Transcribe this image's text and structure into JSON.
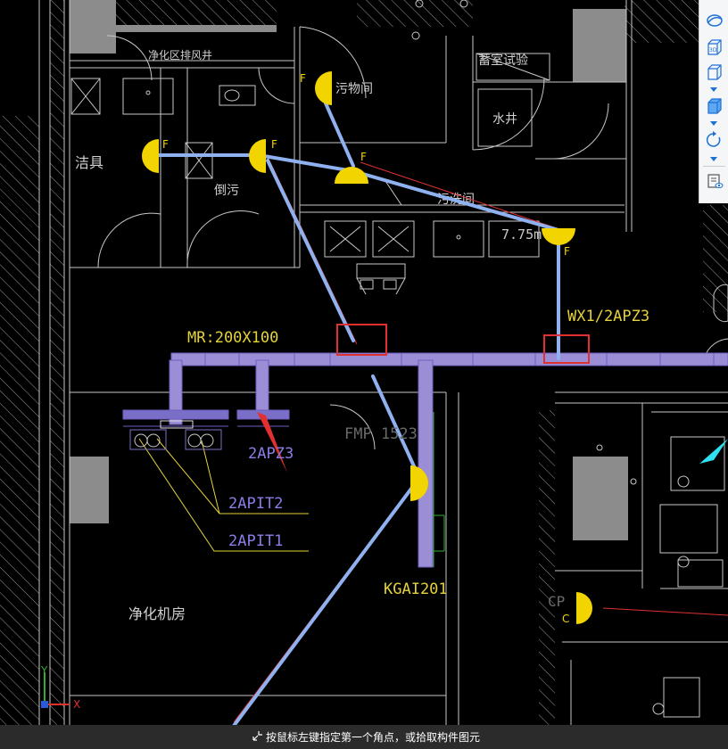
{
  "drawing": {
    "room_labels": {
      "clean_exhaust_shaft": "净化区排风井",
      "sanitary_ware": "洁具",
      "sewage_room": "污物间",
      "sewage_tilted": "倒污",
      "cleaning_room": "污洗间",
      "storage_water": "蓄室试验",
      "water_well": "水井",
      "purification_room": "净化机房"
    },
    "tags": {
      "mr_size": "MR:200X100",
      "wx_panel": "WX1/2APZ3",
      "apz": "2APZ3",
      "apit2": "2APIT2",
      "apit1": "2APIT1",
      "kgai": "KGAI201",
      "fmp": "FMP 1523",
      "elevation": "7.75m",
      "f_marker": "F",
      "c_marker": "C",
      "cp_marker": "CP"
    },
    "axis": {
      "x": "X",
      "y": "Y"
    }
  },
  "view_tools": [
    {
      "name": "orbit-icon",
      "label": ""
    },
    {
      "name": "view-3d-icon",
      "label": "3D"
    },
    {
      "name": "box-outline-icon",
      "label": ""
    },
    {
      "name": "box-solid-icon",
      "label": ""
    },
    {
      "name": "rotate-icon",
      "label": ""
    },
    {
      "name": "layer-visibility-icon",
      "label": ""
    }
  ],
  "status": {
    "prompt": "按鼠标左键指定第一个角点，或拾取构件图元"
  },
  "colors": {
    "background": "#000000",
    "wall_line": "#c8c8c8",
    "gray_block": "#8c8c8c",
    "pipe": "#8fb1f0",
    "tray_fill": "#9b8dd6",
    "tray_stroke": "#6f5fc0",
    "marker": "#f2d400",
    "label_yellow": "#e6d23a",
    "label_purple": "#8a7ee8",
    "red": "#e03030",
    "green": "#2fb02f"
  }
}
